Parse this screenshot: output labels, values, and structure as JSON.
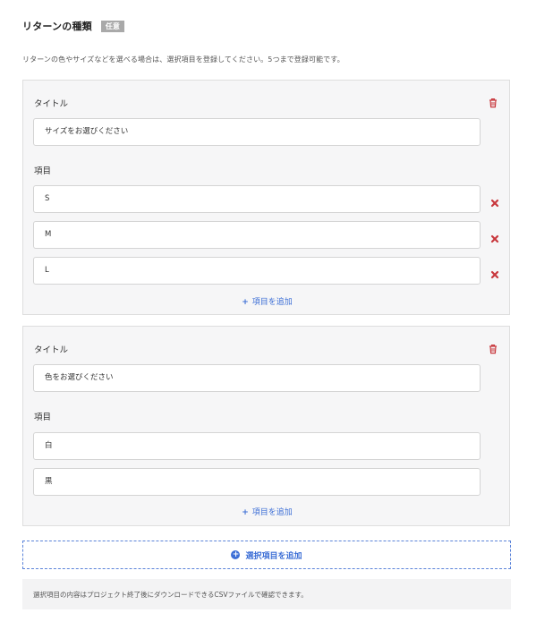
{
  "header": {
    "title": "リターンの種類",
    "badge": "任意"
  },
  "description": "リターンの色やサイズなどを選べる場合は、選択項目を登録してください。5つまで登録可能です。",
  "groups": [
    {
      "title_label": "タイトル",
      "title_value": "サイズをお選びください",
      "items_label": "項目",
      "items": [
        "S",
        "M",
        "L"
      ],
      "add_item_label": "項目を追加"
    },
    {
      "title_label": "タイトル",
      "title_value": "色をお選びください",
      "items_label": "項目",
      "items": [
        "白",
        "黒"
      ],
      "add_item_label": "項目を追加"
    }
  ],
  "add_choice_label": "選択項目を追加",
  "note": "選択項目の内容はプロジェクト終了後にダウンロードできるCSVファイルで確認できます。",
  "icons": {
    "delete_group": "trash-icon",
    "remove_item": "close-x-icon",
    "add_item": "plus-icon",
    "add_choice": "plus-circle-icon"
  },
  "colors": {
    "accent": "#3d6fd6",
    "danger": "#c8383d",
    "badge": "#a9a9a9"
  }
}
